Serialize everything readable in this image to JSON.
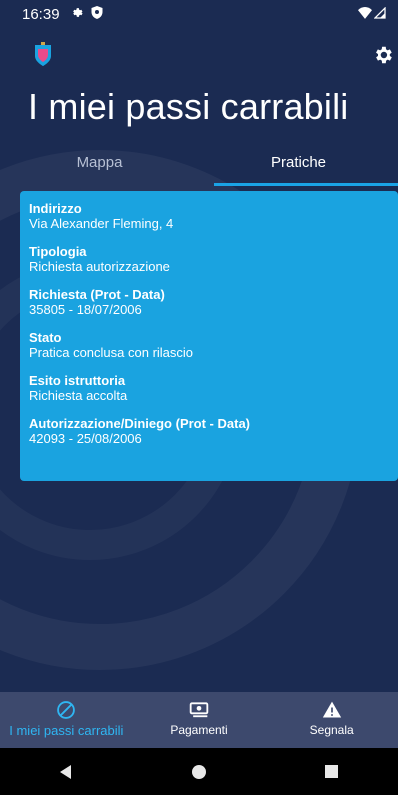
{
  "status_bar": {
    "time": "16:39",
    "icons": [
      "settings-gear-icon",
      "shield-icon",
      "wifi-icon",
      "signal-icon"
    ]
  },
  "app": {
    "title": "I miei passi carrabili",
    "logo_icon": "crest-icon",
    "settings_icon": "gear-icon"
  },
  "tabs": [
    {
      "label": "Mappa",
      "active": false
    },
    {
      "label": "Pratiche",
      "active": true
    }
  ],
  "record": {
    "fields": [
      {
        "label": "Indirizzo",
        "value": "Via Alexander Fleming, 4"
      },
      {
        "label": "Tipologia",
        "value": "Richiesta autorizzazione"
      },
      {
        "label": "Richiesta (Prot - Data)",
        "value": "35805 - 18/07/2006"
      },
      {
        "label": "Stato",
        "value": "Pratica conclusa con rilascio"
      },
      {
        "label": "Esito istruttoria",
        "value": "Richiesta accolta"
      },
      {
        "label": "Autorizzazione/Diniego (Prot - Data)",
        "value": "42093 - 25/08/2006"
      }
    ]
  },
  "bottom_nav": [
    {
      "label": "I miei passi carrabili",
      "icon": "no-entry-icon",
      "active": true
    },
    {
      "label": "Pagamenti",
      "icon": "payment-icon",
      "active": false
    },
    {
      "label": "Segnala",
      "icon": "warning-icon",
      "active": false
    }
  ],
  "system_nav": [
    "back-icon",
    "home-icon",
    "recents-icon"
  ],
  "colors": {
    "background": "#1b2b52",
    "accent": "#1aa3e0",
    "active_nav": "#2fb6f2",
    "bottom_nav_bg": "#3d496d"
  }
}
